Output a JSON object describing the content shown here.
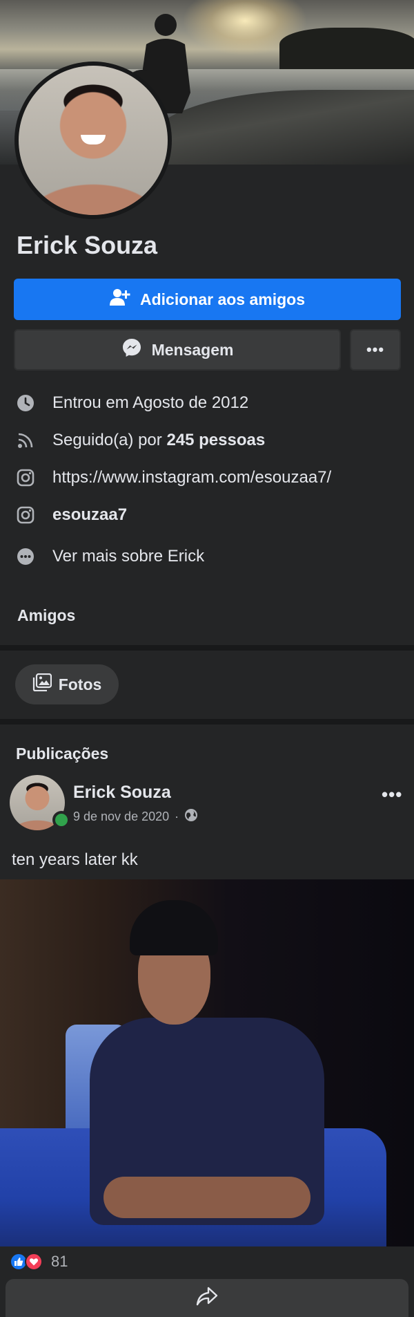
{
  "profile": {
    "name": "Erick Souza"
  },
  "actions": {
    "add_friend_label": "Adicionar aos amigos",
    "message_label": "Mensagem",
    "more_label": "•••"
  },
  "info": {
    "joined": "Entrou em Agosto de 2012",
    "followed_prefix": "Seguido(a) por ",
    "followed_count": "245 pessoas",
    "instagram_url": "https://www.instagram.com/esouzaa7/",
    "instagram_user": "esouzaa7",
    "see_more": "Ver mais sobre Erick"
  },
  "sections": {
    "friends": "Amigos",
    "photos": "Fotos",
    "posts": "Publicações"
  },
  "post": {
    "author": "Erick Souza",
    "date": "9 de nov de 2020",
    "separator": "·",
    "more_label": "•••",
    "text": "ten years later kk",
    "reaction_count": "81"
  },
  "icons": {
    "clock": "clock-icon",
    "followers": "rss-icon",
    "instagram": "instagram-icon",
    "more": "more-circle-icon",
    "photos": "photos-icon",
    "globe": "globe-icon",
    "share": "share-icon",
    "add_friend": "add-friend-icon",
    "messenger": "messenger-icon"
  },
  "colors": {
    "background": "#242526",
    "primary_button": "#1877f2",
    "secondary_button": "#3a3b3c",
    "online": "#31a24c",
    "like": "#1877f2",
    "love": "#f33e58"
  }
}
